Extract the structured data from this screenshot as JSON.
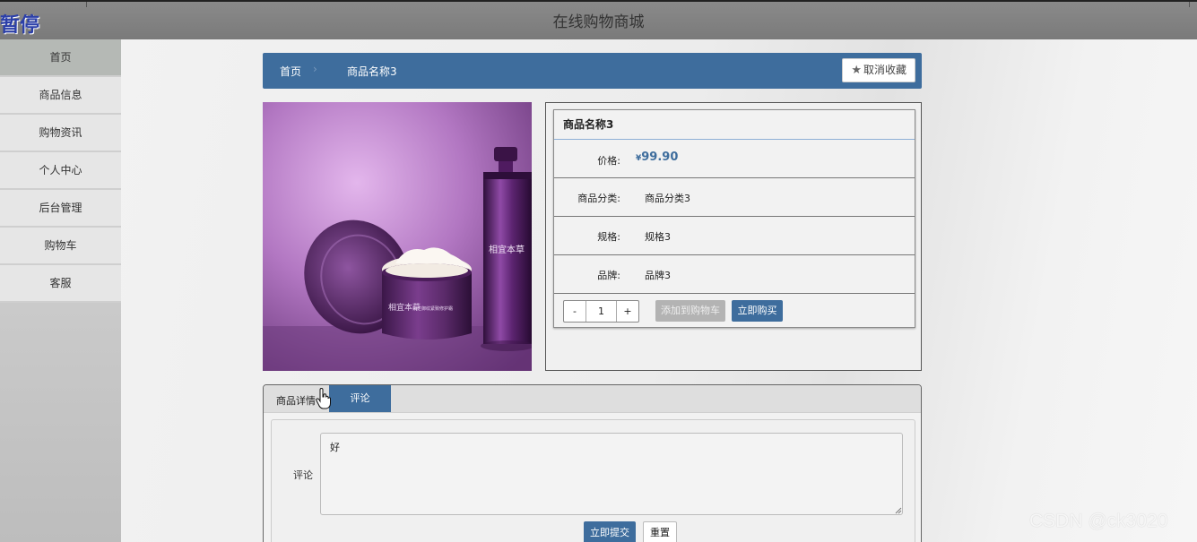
{
  "topbar": {
    "pause_label": "暂停",
    "site_title": "在线购物商城"
  },
  "sidebar": {
    "items": [
      {
        "label": "首页",
        "active": true
      },
      {
        "label": "商品信息"
      },
      {
        "label": "购物资讯"
      },
      {
        "label": "个人中心"
      },
      {
        "label": "后台管理"
      },
      {
        "label": "购物车"
      },
      {
        "label": "客服"
      }
    ]
  },
  "breadcrumb": {
    "home": "首页",
    "separator": "›",
    "current": "商品名称3",
    "favorite_button": "取消收藏"
  },
  "product": {
    "name": "商品名称3",
    "price_label": "价格:",
    "currency": "¥",
    "price": "99.90",
    "category_label": "商品分类:",
    "category": "商品分类3",
    "spec_label": "规格:",
    "spec": "规格3",
    "brand_label": "品牌:",
    "brand": "品牌3",
    "qty_minus": "-",
    "quantity": "1",
    "qty_plus": "+",
    "add_to_cart": "添加到购物车",
    "buy_now": "立即购买"
  },
  "tabs": {
    "detail": "商品详情",
    "comment": "评论",
    "active": "comment"
  },
  "comment_form": {
    "label": "评论",
    "value": "好",
    "submit": "立即提交",
    "reset": "重置"
  },
  "watermark": "CSDN @ck3020",
  "colors": {
    "primary": "#3e6d9d",
    "topbar": "#808080",
    "disabled_button": "#b3b3b3"
  }
}
